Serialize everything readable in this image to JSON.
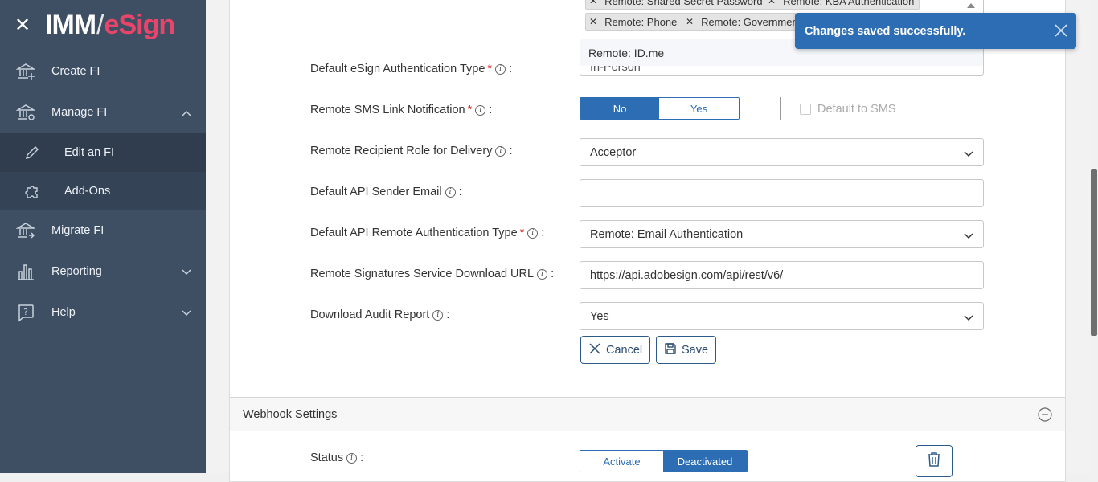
{
  "sidebar": {
    "logo": {
      "part1": "IMM",
      "slash": "/",
      "part2": "eSign"
    },
    "items": [
      {
        "label": "Create FI"
      },
      {
        "label": "Manage FI"
      },
      {
        "label": "Edit an FI"
      },
      {
        "label": "Add-Ons"
      },
      {
        "label": "Migrate FI"
      },
      {
        "label": "Reporting"
      },
      {
        "label": "Help"
      }
    ]
  },
  "auth_multi": {
    "tags": [
      "Remote: Shared Secret Password",
      "Remote: KBA Authentication",
      "Remote: Phone",
      "Remote: Government"
    ],
    "dropdown_option": "Remote: ID.me",
    "underlying_value": "In-Person"
  },
  "form": {
    "default_esign_auth_label": "Default eSign Authentication Type",
    "remote_sms_label": "Remote SMS Link Notification",
    "sms_toggle": {
      "no": "No",
      "yes": "Yes",
      "selected": "No"
    },
    "default_to_sms": "Default to SMS",
    "recipient_role_label": "Remote Recipient Role for Delivery",
    "recipient_role_value": "Acceptor",
    "api_sender_email_label": "Default API Sender Email",
    "api_sender_email_value": "",
    "api_remote_auth_label": "Default API Remote Authentication Type",
    "api_remote_auth_value": "Remote: Email Authentication",
    "download_url_label": "Remote Signatures Service Download URL",
    "download_url_value": "https://api.adobesign.com/api/rest/v6/",
    "audit_report_label": "Download Audit Report",
    "audit_report_value": "Yes",
    "colon": ":",
    "required_mark": "*",
    "info_glyph": "i"
  },
  "actions": {
    "cancel": "Cancel",
    "save": "Save"
  },
  "webhook": {
    "title": "Webhook Settings",
    "status_label": "Status",
    "status_toggle": {
      "activate": "Activate",
      "deactivated": "Deactivated",
      "selected": "Deactivated"
    }
  },
  "toast": {
    "message": "Changes saved successfully."
  },
  "colors": {
    "primary": "#2c6db3",
    "sidebar": "#3e4e63",
    "accent": "#e8456a",
    "required": "#d9342b"
  }
}
